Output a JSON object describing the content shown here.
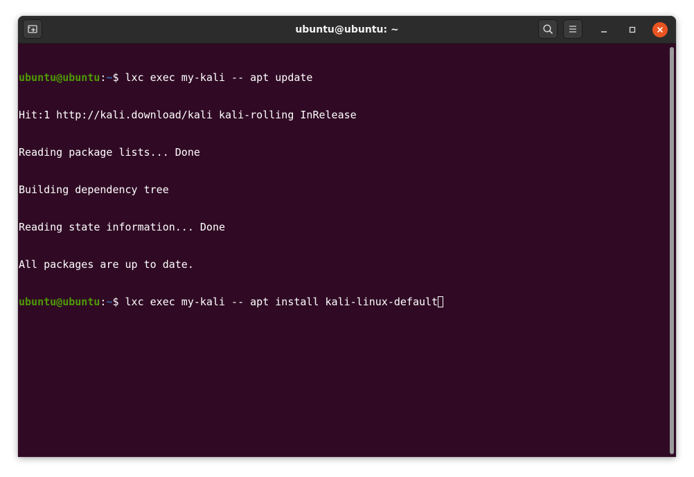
{
  "window": {
    "title": "ubuntu@ubuntu: ~"
  },
  "icons": {
    "new_tab": "new-tab-icon",
    "search": "search-icon",
    "menu": "hamburger-menu-icon",
    "minimize": "minimize-icon",
    "maximize": "maximize-icon",
    "close": "close-icon"
  },
  "colors": {
    "terminal_bg": "#300a24",
    "prompt_user": "#4e9a06",
    "prompt_path": "#3465a4",
    "close_button": "#e95420",
    "headerbar": "#2c2c2c"
  },
  "terminal": {
    "lines": [
      {
        "type": "prompt",
        "user": "ubuntu@ubuntu",
        "sep": ":",
        "path": "~",
        "symbol": "$ ",
        "command": "lxc exec my-kali -- apt update"
      },
      {
        "type": "output",
        "text": "Hit:1 http://kali.download/kali kali-rolling InRelease"
      },
      {
        "type": "output",
        "text": "Reading package lists... Done"
      },
      {
        "type": "output",
        "text": "Building dependency tree"
      },
      {
        "type": "output",
        "text": "Reading state information... Done"
      },
      {
        "type": "output",
        "text": "All packages are up to date."
      },
      {
        "type": "prompt",
        "user": "ubuntu@ubuntu",
        "sep": ":",
        "path": "~",
        "symbol": "$ ",
        "command": "lxc exec my-kali -- apt install kali-linux-default"
      }
    ]
  }
}
